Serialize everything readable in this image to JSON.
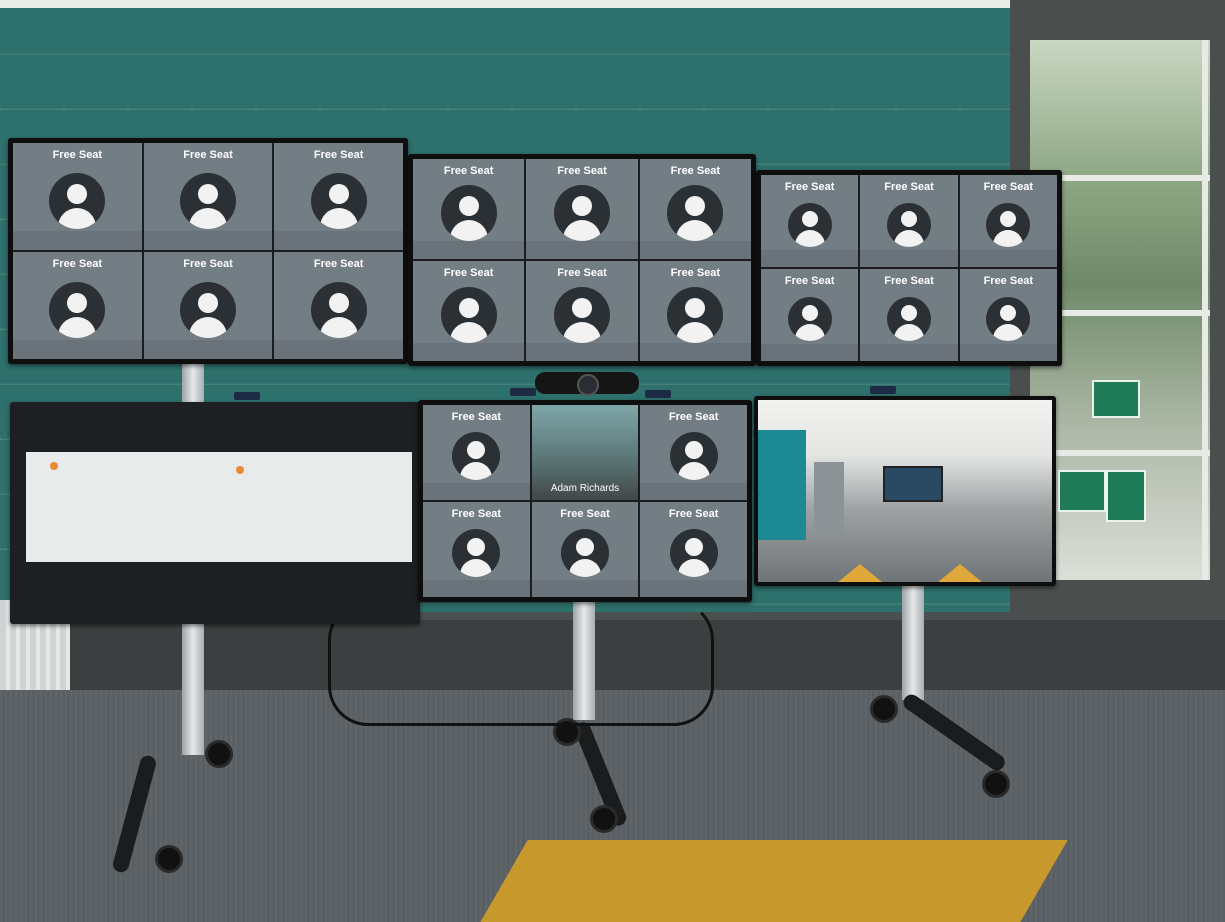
{
  "top_row": {
    "left_screen": {
      "tiles": [
        {
          "label": "Free Seat"
        },
        {
          "label": "Free Seat"
        },
        {
          "label": "Free Seat"
        },
        {
          "label": "Free Seat"
        },
        {
          "label": "Free Seat"
        },
        {
          "label": "Free Seat"
        }
      ]
    },
    "middle_screen": {
      "tiles": [
        {
          "label": "Free Seat"
        },
        {
          "label": "Free Seat"
        },
        {
          "label": "Free Seat"
        },
        {
          "label": "Free Seat"
        },
        {
          "label": "Free Seat"
        },
        {
          "label": "Free Seat"
        }
      ]
    },
    "right_screen": {
      "tiles": [
        {
          "label": "Free Seat"
        },
        {
          "label": "Free Seat"
        },
        {
          "label": "Free Seat"
        },
        {
          "label": "Free Seat"
        },
        {
          "label": "Free Seat"
        },
        {
          "label": "Free Seat"
        }
      ]
    }
  },
  "bottom_row": {
    "middle_screen": {
      "tiles": [
        {
          "label": "Free Seat"
        },
        {
          "label": "Adam Richards",
          "type": "video"
        },
        {
          "label": "Free Seat"
        },
        {
          "label": "Free Seat"
        },
        {
          "label": "Free Seat"
        },
        {
          "label": "Free Seat"
        }
      ]
    }
  },
  "colors": {
    "wall": "#2e706c",
    "tile": "#737d84",
    "avatar_bg": "#2b3034",
    "rug": "#c7992c"
  }
}
